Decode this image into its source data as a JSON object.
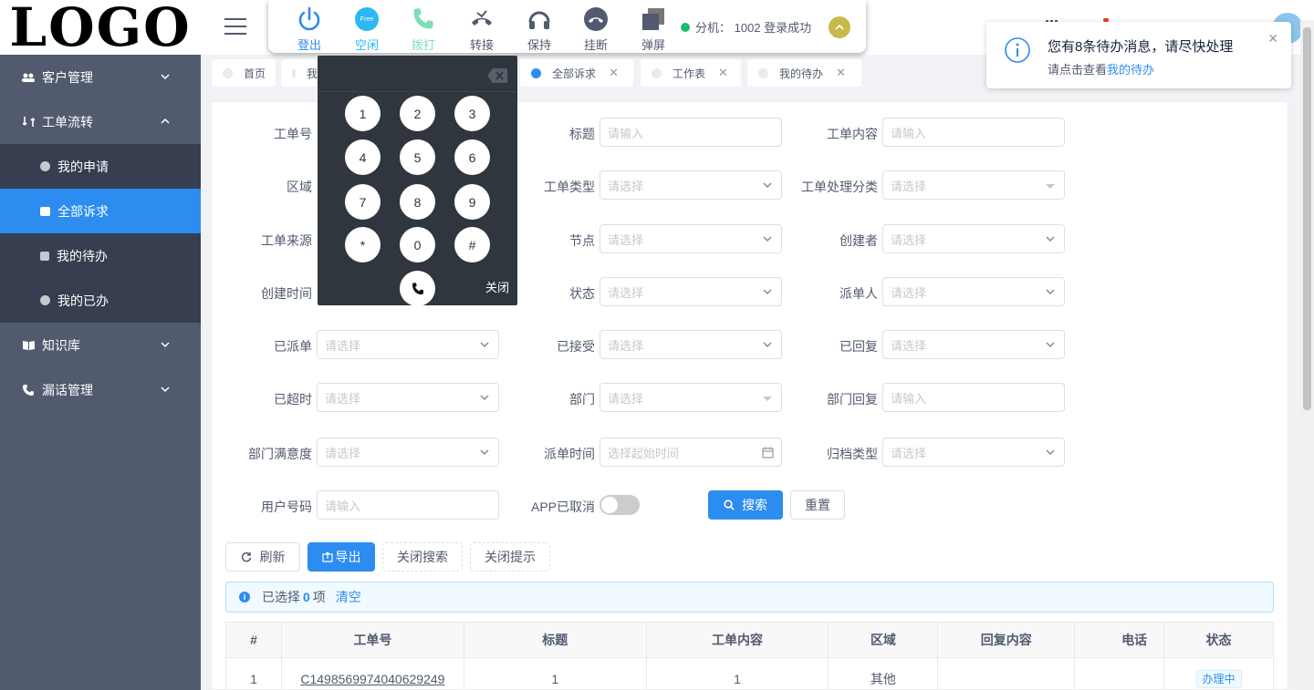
{
  "logo": "LOGO",
  "sidebar": {
    "items": [
      {
        "label": "客户管理"
      },
      {
        "label": "工单流转"
      },
      {
        "label": "知识库"
      },
      {
        "label": "漏话管理"
      }
    ],
    "sub_items": [
      {
        "label": "我的申请"
      },
      {
        "label": "全部诉求"
      },
      {
        "label": "我的待办"
      },
      {
        "label": "我的已办"
      }
    ]
  },
  "phonebar": {
    "items": [
      {
        "label": "登出",
        "color": "#2d8cf0"
      },
      {
        "label": "空闲",
        "color": "#2db7f5",
        "badge": "Free"
      },
      {
        "label": "拨打",
        "color": "#7be0b5"
      },
      {
        "label": "转接",
        "color": "#515a6e"
      },
      {
        "label": "保持",
        "color": "#515a6e"
      },
      {
        "label": "挂断",
        "color": "#515a6e"
      },
      {
        "label": "弹屏",
        "color": "#515a6e"
      }
    ],
    "status": "分机： 1002 登录成功"
  },
  "tabs": [
    {
      "label": "首页",
      "active": false
    },
    {
      "label": "我",
      "active": false
    },
    {
      "label": "全部诉求",
      "active": true
    },
    {
      "label": "工作表",
      "active": false
    },
    {
      "label": "我的待办",
      "active": false
    }
  ],
  "dialpad": {
    "keys": [
      "1",
      "2",
      "3",
      "4",
      "5",
      "6",
      "7",
      "8",
      "9",
      "*",
      "0",
      "#"
    ],
    "close": "关闭"
  },
  "notice": {
    "title": "您有8条待办消息，请尽快处理",
    "desc_prefix": "请点击查看",
    "desc_link": "我的待办"
  },
  "form": {
    "fields": [
      {
        "label": "工单号",
        "placeholder": ""
      },
      {
        "label": "标题",
        "placeholder": "请输入"
      },
      {
        "label": "工单内容",
        "placeholder": "请输入"
      },
      {
        "label": "区域",
        "placeholder": ""
      },
      {
        "label": "工单类型",
        "placeholder": "请选择"
      },
      {
        "label": "工单处理分类",
        "placeholder": "请选择"
      },
      {
        "label": "工单来源",
        "placeholder": ""
      },
      {
        "label": "节点",
        "placeholder": "请选择"
      },
      {
        "label": "创建者",
        "placeholder": "请选择"
      },
      {
        "label": "创建时间",
        "placeholder": ""
      },
      {
        "label": "状态",
        "placeholder": "请选择"
      },
      {
        "label": "派单人",
        "placeholder": "请选择"
      },
      {
        "label": "已派单",
        "placeholder": "请选择"
      },
      {
        "label": "已接受",
        "placeholder": "请选择"
      },
      {
        "label": "已回复",
        "placeholder": "请选择"
      },
      {
        "label": "已超时",
        "placeholder": "请选择"
      },
      {
        "label": "部门",
        "placeholder": "请选择"
      },
      {
        "label": "部门回复",
        "placeholder": "请输入"
      },
      {
        "label": "部门满意度",
        "placeholder": "请选择"
      },
      {
        "label": "派单时间",
        "placeholder": "选择起始时间"
      },
      {
        "label": "归档类型",
        "placeholder": "请选择"
      },
      {
        "label": "用户号码",
        "placeholder": "请输入"
      },
      {
        "label": "APP已取消",
        "placeholder": ""
      }
    ],
    "search_btn": "搜索",
    "reset_btn": "重置"
  },
  "toolbar": {
    "refresh": "刷新",
    "export": "导出",
    "close_search": "关闭搜索",
    "close_tip": "关闭提示"
  },
  "selection": {
    "prefix": "已选择",
    "count": "0",
    "suffix": "项",
    "clear": "清空"
  },
  "table": {
    "headers": [
      "#",
      "工单号",
      "标题",
      "工单内容",
      "区域",
      "回复内容",
      "电话",
      "状态"
    ],
    "rows": [
      {
        "index": "1",
        "order_no": "C1498569974040629249",
        "title": "1",
        "content": "1",
        "region": "其他",
        "reply": "",
        "phone": "",
        "status": "办理中"
      }
    ]
  }
}
